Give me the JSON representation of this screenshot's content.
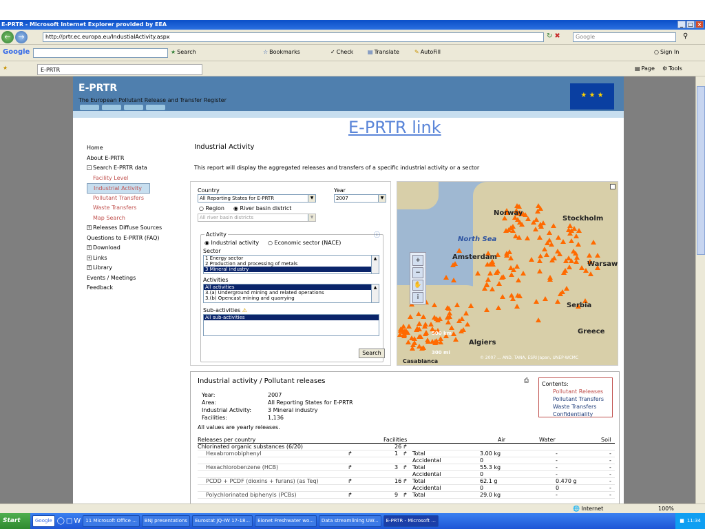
{
  "window": {
    "title": "E-PRTR - Microsoft Internet Explorer provided by EEA",
    "minimize": "_",
    "maximize": "□",
    "close": "×"
  },
  "address": {
    "url": "http://prtr.ec.europa.eu/IndustialActivity.aspx",
    "search_placeholder": "Google"
  },
  "google_toolbar": {
    "logo": "Google",
    "search": "Search",
    "bookmarks": "Bookmarks",
    "check": "Check",
    "translate": "Translate",
    "autofill": "AutoFill",
    "signin": "Sign In"
  },
  "favbar": {
    "tab": "E-PRTR",
    "page": "Page",
    "tools": "Tools"
  },
  "banner": {
    "title": "E-PRTR",
    "subtitle": "The European Pollutant Release and Transfer Register"
  },
  "link_title": "E-PRTR link",
  "nav": [
    {
      "label": "Home",
      "type": "top"
    },
    {
      "label": "About E-PRTR",
      "type": "top"
    },
    {
      "label": "Search E-PRTR data",
      "type": "tree",
      "sign": "-"
    },
    {
      "label": "Facility Level",
      "type": "sub"
    },
    {
      "label": "Industrial Activity",
      "type": "sub",
      "selected": true
    },
    {
      "label": "Pollutant Releases",
      "type": "sub"
    },
    {
      "label": "Pollutant Transfers",
      "type": "sub"
    },
    {
      "label": "Waste Transfers",
      "type": "sub"
    },
    {
      "label": "Map Search",
      "type": "sub"
    },
    {
      "label": "Releases Diffuse Sources",
      "type": "tree",
      "sign": "+"
    },
    {
      "label": "Questions to E-PRTR (FAQ)",
      "type": "top"
    },
    {
      "label": "Download",
      "type": "tree",
      "sign": "+"
    },
    {
      "label": "Links",
      "type": "tree",
      "sign": "+"
    },
    {
      "label": "Library",
      "type": "tree",
      "sign": "+"
    },
    {
      "label": "Events / Meetings",
      "type": "top"
    },
    {
      "label": "Feedback",
      "type": "top"
    }
  ],
  "heading": "Industrial Activity",
  "description": "This report will display the aggregated releases and transfers of a specific industrial activity or a sector",
  "form": {
    "country_label": "Country",
    "country_value": "All Reporting States for E-PRTR",
    "year_label": "Year",
    "year_value": "2007",
    "region": "Region",
    "river": "River basin district",
    "river_value": "All river basin districts",
    "activity_legend": "Activity",
    "ind_activity": "Industrial activity",
    "eco_sector": "Economic sector (NACE)",
    "sector_label": "Sector",
    "sectors": [
      "1 Energy sector",
      "2 Production and processing of metals",
      "3 Mineral industry"
    ],
    "activities_label": "Activities",
    "activities": [
      "All activities",
      "3.(a) Underground mining and related operations",
      "3.(b) Opencast mining and quarrying"
    ],
    "subact_label": "Sub-activities",
    "subacts": [
      "All sub-activities"
    ],
    "search": "Search"
  },
  "map": {
    "labels": {
      "norway": "Norway",
      "stockholm": "Stockholm",
      "north_sea": "North Sea",
      "amsterdam": "Amsterdam",
      "warsaw": "Warsaw",
      "serbia": "Serbia",
      "greece": "Greece",
      "algiers": "Algiers",
      "casablanca": "Casablanca",
      "scale_km": "500 km",
      "scale_mi": "300 mi"
    },
    "copyright": "© 2007 ... AND, TANA, ESRI Japan, UNEP-WCMC"
  },
  "results": {
    "title": "Industrial activity / Pollutant releases",
    "meta": [
      {
        "k": "Year:",
        "v": "2007"
      },
      {
        "k": "Area:",
        "v": "All Reporting States for E-PRTR"
      },
      {
        "k": "Industrial Activity:",
        "v": "3 Mineral industry"
      },
      {
        "k": "Facilities:",
        "v": "1,136"
      }
    ],
    "note": "All values are yearly releases.",
    "contents": {
      "title": "Contents:",
      "links": [
        "Pollutant Releases",
        "Pollutant Transfers",
        "Waste Transfers",
        "Confidentiality"
      ]
    },
    "headers": {
      "country": "Releases per country",
      "fac": "Facilities",
      "air": "Air",
      "water": "Water",
      "soil": "Soil"
    },
    "rows": [
      {
        "name": "Chlorinated organic substances (6/20)",
        "fac": "26",
        "type": "",
        "air": "",
        "water": "",
        "soil": "",
        "group": true
      },
      {
        "name": "Hexabromobiphenyl",
        "fac": "1",
        "type": "Total",
        "air": "3.00 kg",
        "water": "-",
        "soil": "-"
      },
      {
        "name": "",
        "fac": "",
        "type": "Accidental",
        "air": "0",
        "water": "-",
        "soil": "-"
      },
      {
        "name": "Hexachlorobenzene (HCB)",
        "fac": "3",
        "type": "Total",
        "air": "55.3 kg",
        "water": "-",
        "soil": "-"
      },
      {
        "name": "",
        "fac": "",
        "type": "Accidental",
        "air": "0",
        "water": "-",
        "soil": "-"
      },
      {
        "name": "PCDD + PCDF (dioxins + furans) (as Teq)",
        "fac": "16",
        "type": "Total",
        "air": "62.1 g",
        "water": "0.470 g",
        "soil": "-"
      },
      {
        "name": "",
        "fac": "",
        "type": "Accidental",
        "air": "0",
        "water": "0",
        "soil": "-"
      },
      {
        "name": "Polychlorinated biphenyls (PCBs)",
        "fac": "9",
        "type": "Total",
        "air": "29.0 kg",
        "water": "-",
        "soil": "-"
      }
    ]
  },
  "status": {
    "zone": "Internet",
    "zoom": "100%"
  },
  "taskbar": {
    "start": "Start",
    "google": "Google",
    "items": [
      "11 Microsoft Office ...",
      "BNJ presentations",
      "Eurostat JQ-IW 17-18...",
      "Eionet Freshwater wo...",
      "Data streamlining UW...",
      "E-PRTR - Microsoft ..."
    ],
    "clock": "11:34"
  },
  "colors": {
    "accent": "#4f7fae",
    "nav_red": "#c0504d",
    "map_marker": "#ff6a00"
  }
}
